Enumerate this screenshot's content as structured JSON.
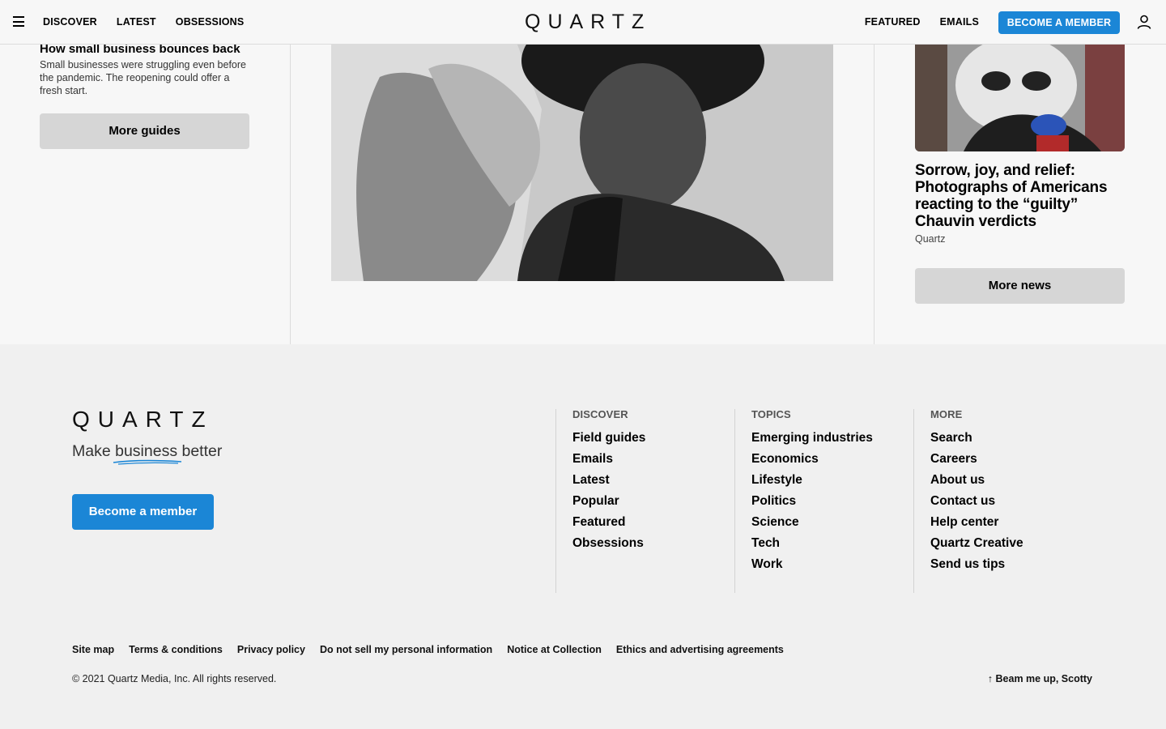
{
  "nav": {
    "left": [
      "DISCOVER",
      "LATEST",
      "OBSESSIONS"
    ],
    "right": [
      "FEATURED",
      "EMAILS"
    ],
    "logo": "QUARTZ",
    "member_button": "BECOME A MEMBER",
    "menu_icon": "hamburger-icon",
    "account_icon": "user-icon"
  },
  "left_column": {
    "guide_title": "How small business bounces back",
    "guide_description": "Small businesses were struggling even before the pandemic. The reopening could offer a fresh start.",
    "more_button": "More guides"
  },
  "center_column": {
    "image": "barbershop-photo"
  },
  "right_column": {
    "headline": "Sorrow, joy, and relief: Photographs of Americans reacting to the “guilty” Chauvin verdicts",
    "byline": "Quartz",
    "more_button": "More news"
  },
  "footer": {
    "logo": "QUARTZ",
    "tagline_before": "Make ",
    "tagline_word": "business",
    "tagline_after": " better",
    "member_button": "Become a member",
    "columns": [
      {
        "heading": "DISCOVER",
        "links": [
          "Field guides",
          "Emails",
          "Latest",
          "Popular",
          "Featured",
          "Obsessions"
        ]
      },
      {
        "heading": "TOPICS",
        "links": [
          "Emerging industries",
          "Economics",
          "Lifestyle",
          "Politics",
          "Science",
          "Tech",
          "Work"
        ]
      },
      {
        "heading": "MORE",
        "links": [
          "Search",
          "Careers",
          "About us",
          "Contact us",
          "Help center",
          "Quartz Creative",
          "Send us tips"
        ]
      }
    ],
    "legal_links": [
      "Site map",
      "Terms & conditions",
      "Privacy policy",
      "Do not sell my personal information",
      "Notice at Collection",
      "Ethics and advertising agreements"
    ],
    "copyright": "© 2021 Quartz Media, Inc. All rights reserved.",
    "back_to_top": "↑ Beam me up, Scotty",
    "accent_color": "#1b86d6"
  }
}
